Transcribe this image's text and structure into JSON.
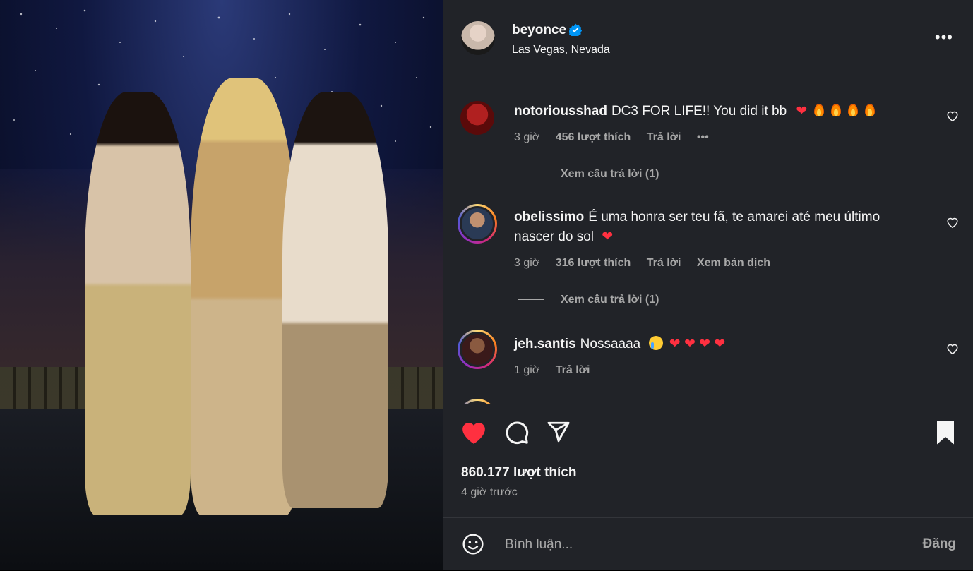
{
  "post": {
    "author": "beyonce",
    "location": "Las Vegas, Nevada",
    "likes": "860.177 lượt thích",
    "time": "4 giờ trước",
    "liked": true,
    "saved": true
  },
  "comments": [
    {
      "user": "notoriousshad",
      "text": "DC3 FOR LIFE!! You did it bb",
      "emojis": "❤️🔥🔥🔥🔥",
      "time": "3 giờ",
      "likes": "456 lượt thích",
      "reply_label": "Trả lời",
      "more": "•••",
      "view_replies": "Xem câu trả lời (1)"
    },
    {
      "user": "obelissimo",
      "text": "É uma honra ser teu fã, te amarei até meu último nascer do sol",
      "emojis": "❤️",
      "time": "3 giờ",
      "likes": "316 lượt thích",
      "reply_label": "Trả lời",
      "translate_label": "Xem bản dịch",
      "view_replies": "Xem câu trả lời (1)"
    },
    {
      "user": "jeh.santis",
      "text": "Nossaaaa",
      "emojis": "😭❤️❤️❤️❤️",
      "time": "1 giờ",
      "reply_label": "Trả lời"
    }
  ],
  "composer": {
    "placeholder": "Bình luận...",
    "post_label": "Đăng"
  },
  "colors": {
    "panel_bg": "#212328",
    "like_red": "#ff3040",
    "verified_blue": "#0095f6",
    "secondary_text": "#a8a8a8"
  }
}
